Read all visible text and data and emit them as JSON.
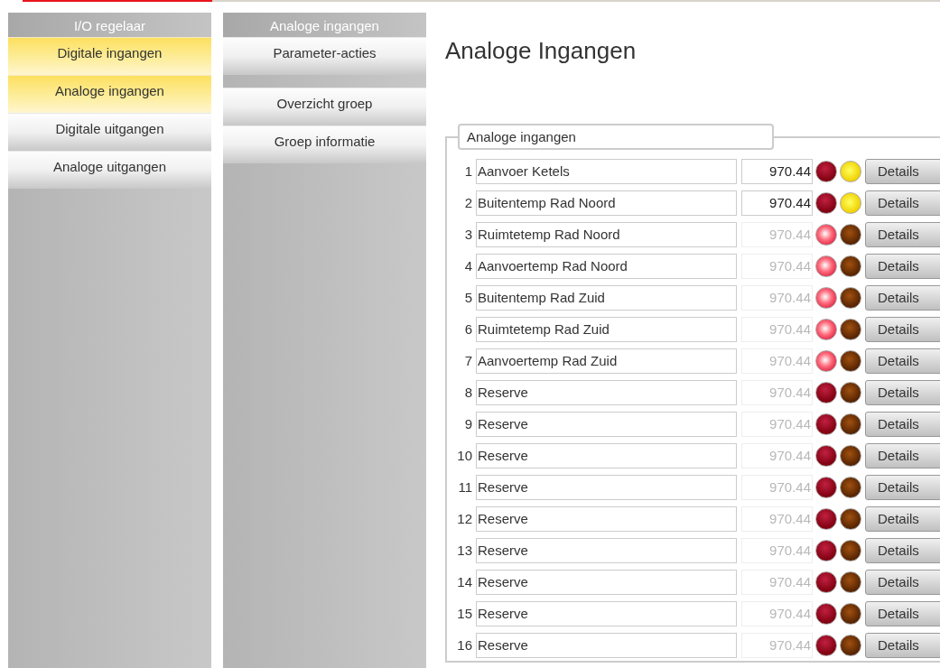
{
  "menu": {
    "title": "I/O regelaar",
    "items": [
      {
        "label": "Digitale ingangen",
        "selected": true
      },
      {
        "label": "Analoge ingangen",
        "selected": true
      },
      {
        "label": "Digitale uitgangen",
        "selected": false
      },
      {
        "label": "Analoge uitgangen",
        "selected": false
      }
    ]
  },
  "submenu": {
    "title": "Analoge ingangen",
    "groups": [
      [
        "Parameter-acties"
      ],
      [
        "Overzicht groep",
        "Groep informatie"
      ]
    ]
  },
  "page_title": "Analoge Ingangen",
  "group": {
    "legend": "Analoge ingangen",
    "rows": [
      {
        "number": "1",
        "name": "Aanvoer Ketels",
        "value": "970.44",
        "disabled": false,
        "alarm_on": false,
        "status_on": true,
        "button": "Details"
      },
      {
        "number": "2",
        "name": "Buitentemp Rad Noord",
        "value": "970.44",
        "disabled": false,
        "alarm_on": false,
        "status_on": true,
        "button": "Details"
      },
      {
        "number": "3",
        "name": "Ruimtetemp Rad Noord",
        "value": "970.44",
        "disabled": true,
        "alarm_on": true,
        "status_on": false,
        "button": "Details"
      },
      {
        "number": "4",
        "name": "Aanvoertemp Rad Noord",
        "value": "970.44",
        "disabled": true,
        "alarm_on": true,
        "status_on": false,
        "button": "Details"
      },
      {
        "number": "5",
        "name": "Buitentemp Rad Zuid",
        "value": "970.44",
        "disabled": true,
        "alarm_on": true,
        "status_on": false,
        "button": "Details"
      },
      {
        "number": "6",
        "name": "Ruimtetemp Rad Zuid",
        "value": "970.44",
        "disabled": true,
        "alarm_on": true,
        "status_on": false,
        "button": "Details"
      },
      {
        "number": "7",
        "name": "Aanvoertemp Rad Zuid",
        "value": "970.44",
        "disabled": true,
        "alarm_on": true,
        "status_on": false,
        "button": "Details"
      },
      {
        "number": "8",
        "name": "Reserve",
        "value": "970.44",
        "disabled": true,
        "alarm_on": false,
        "status_on": false,
        "button": "Details"
      },
      {
        "number": "9",
        "name": "Reserve",
        "value": "970.44",
        "disabled": true,
        "alarm_on": false,
        "status_on": false,
        "button": "Details"
      },
      {
        "number": "10",
        "name": "Reserve",
        "value": "970.44",
        "disabled": true,
        "alarm_on": false,
        "status_on": false,
        "button": "Details"
      },
      {
        "number": "11",
        "name": "Reserve",
        "value": "970.44",
        "disabled": true,
        "alarm_on": false,
        "status_on": false,
        "button": "Details"
      },
      {
        "number": "12",
        "name": "Reserve",
        "value": "970.44",
        "disabled": true,
        "alarm_on": false,
        "status_on": false,
        "button": "Details"
      },
      {
        "number": "13",
        "name": "Reserve",
        "value": "970.44",
        "disabled": true,
        "alarm_on": false,
        "status_on": false,
        "button": "Details"
      },
      {
        "number": "14",
        "name": "Reserve",
        "value": "970.44",
        "disabled": true,
        "alarm_on": false,
        "status_on": false,
        "button": "Details"
      },
      {
        "number": "15",
        "name": "Reserve",
        "value": "970.44",
        "disabled": true,
        "alarm_on": false,
        "status_on": false,
        "button": "Details"
      },
      {
        "number": "16",
        "name": "Reserve",
        "value": "970.44",
        "disabled": true,
        "alarm_on": false,
        "status_on": false,
        "button": "Details"
      }
    ]
  }
}
